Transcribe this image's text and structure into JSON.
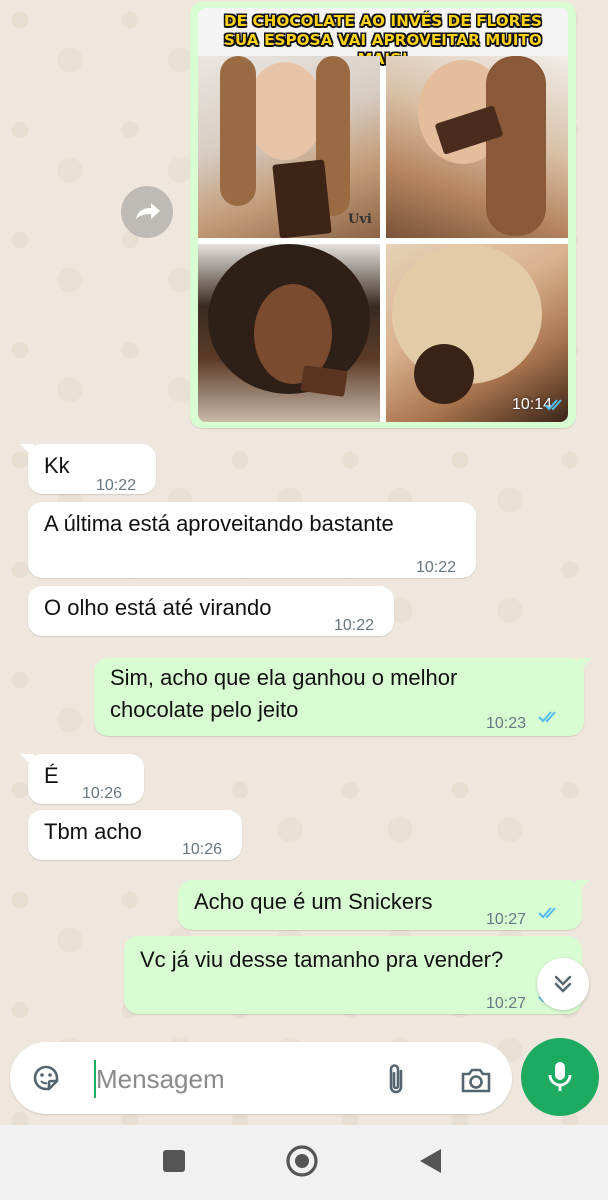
{
  "image_message": {
    "caption_line1": "DE CHOCOLATE AO INVÉS DE FLORES",
    "caption_line2": "SUA ESPOSA VAI APROVEITAR MUITO MAIS!",
    "watermark": "Uvi",
    "time": "10:14"
  },
  "messages": [
    {
      "direction": "in",
      "text": "Kk",
      "time": "10:22"
    },
    {
      "direction": "in",
      "text": "A última está aproveitando bastante",
      "time": "10:22"
    },
    {
      "direction": "in",
      "text": "O olho está até virando",
      "time": "10:22"
    },
    {
      "direction": "out",
      "line1": "Sim, acho que ela ganhou o melhor",
      "line2": "chocolate pelo jeito",
      "time": "10:23"
    },
    {
      "direction": "in",
      "text": "É",
      "time": "10:26"
    },
    {
      "direction": "in",
      "text": "Tbm acho",
      "time": "10:26"
    },
    {
      "direction": "out",
      "text": "Acho que é um Snickers",
      "time": "10:27"
    },
    {
      "direction": "out",
      "text": "Vc já viu desse tamanho pra vender?",
      "time": "10:27"
    }
  ],
  "input": {
    "placeholder": "Mensagem",
    "value": ""
  },
  "colors": {
    "chat_background": "#efe7dd",
    "incoming_bubble": "#ffffff",
    "outgoing_bubble": "#d9fdd3",
    "accent_green": "#1daa61",
    "read_ticks": "#53bdeb",
    "time_text": "#667781"
  },
  "icons": {
    "forward": "forward-icon",
    "scroll_down": "double-chevron-down-icon",
    "sticker": "sticker-icon",
    "attach": "paperclip-icon",
    "camera": "camera-icon",
    "mic": "microphone-icon",
    "nav_recents": "square-icon",
    "nav_home": "circle-icon",
    "nav_back": "triangle-back-icon"
  }
}
